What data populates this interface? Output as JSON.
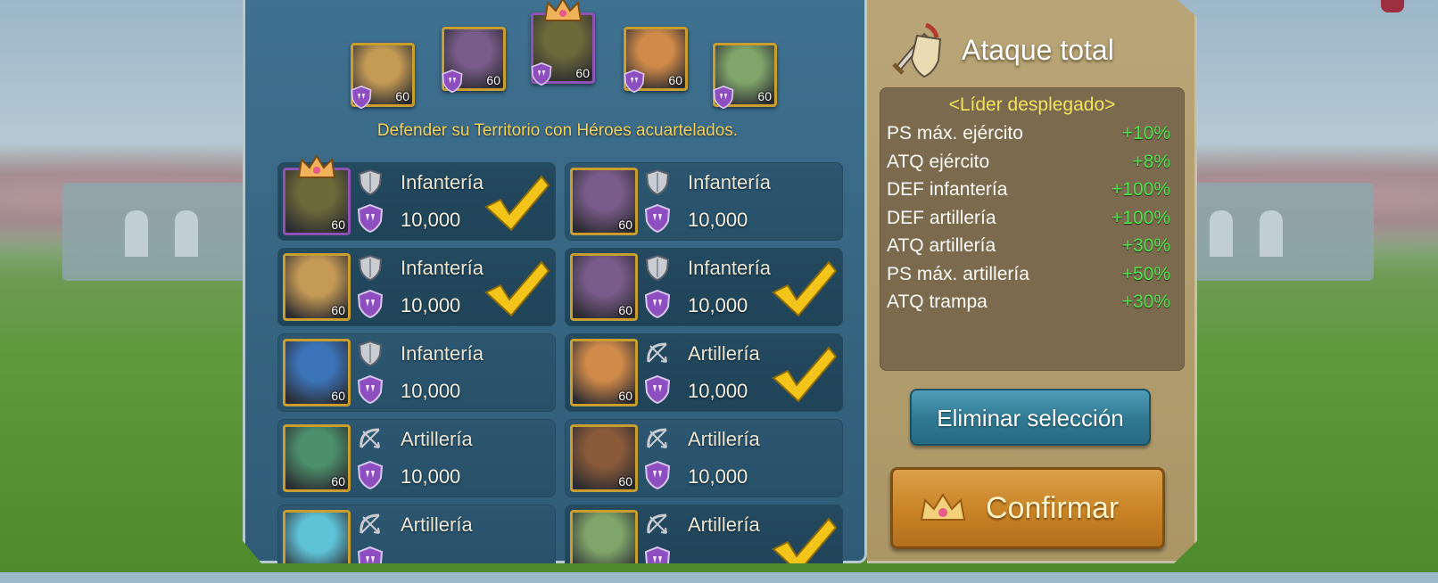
{
  "screen": {
    "subtitle": "Defender su Territorio con Héroes acuartelados."
  },
  "top_heroes": [
    {
      "level": "60",
      "leader": false,
      "palette": "#c59a55"
    },
    {
      "level": "60",
      "leader": false,
      "palette": "#7a5c8a"
    },
    {
      "level": "60",
      "leader": true,
      "palette": "#6b6a3a"
    },
    {
      "level": "60",
      "leader": false,
      "palette": "#d08a4a"
    },
    {
      "level": "60",
      "leader": false,
      "palette": "#7fa56a"
    }
  ],
  "hero_cards": [
    {
      "type_label": "Infantería",
      "troops": "10,000",
      "level": "60",
      "type_icon": "shield-icon",
      "selected": true,
      "leader": true,
      "palette": "#6b6a3a"
    },
    {
      "type_label": "Infantería",
      "troops": "10,000",
      "level": "60",
      "type_icon": "shield-icon",
      "selected": false,
      "leader": false,
      "palette": "#7a5c8a"
    },
    {
      "type_label": "Infantería",
      "troops": "10,000",
      "level": "60",
      "type_icon": "shield-icon",
      "selected": true,
      "leader": false,
      "palette": "#c59a55"
    },
    {
      "type_label": "Infantería",
      "troops": "10,000",
      "level": "60",
      "type_icon": "shield-icon",
      "selected": true,
      "leader": false,
      "palette": "#7a5c8a"
    },
    {
      "type_label": "Infantería",
      "troops": "10,000",
      "level": "60",
      "type_icon": "shield-icon",
      "selected": false,
      "leader": false,
      "palette": "#3b74b8"
    },
    {
      "type_label": "Artillería",
      "troops": "10,000",
      "level": "60",
      "type_icon": "bow-icon",
      "selected": true,
      "leader": false,
      "palette": "#d08a4a"
    },
    {
      "type_label": "Artillería",
      "troops": "10,000",
      "level": "60",
      "type_icon": "bow-icon",
      "selected": false,
      "leader": false,
      "palette": "#4c8f6a"
    },
    {
      "type_label": "Artillería",
      "troops": "10,000",
      "level": "60",
      "type_icon": "bow-icon",
      "selected": false,
      "leader": false,
      "palette": "#8a5a3a"
    },
    {
      "type_label": "Artillería",
      "troops": "",
      "level": "",
      "type_icon": "bow-icon",
      "selected": false,
      "leader": false,
      "palette": "#5fc3d8"
    },
    {
      "type_label": "Artillería",
      "troops": "",
      "level": "",
      "type_icon": "bow-icon",
      "selected": true,
      "leader": false,
      "palette": "#7fa56a"
    }
  ],
  "sidebar": {
    "title": "Ataque total",
    "leader_header": "<Líder desplegado>",
    "bonuses": [
      {
        "label": "PS máx. ejército",
        "value": "+10%"
      },
      {
        "label": "ATQ ejército",
        "value": "+8%"
      },
      {
        "label": "DEF infantería",
        "value": "+100%"
      },
      {
        "label": "DEF artillería",
        "value": "+100%"
      },
      {
        "label": "ATQ artillería",
        "value": "+30%"
      },
      {
        "label": "PS máx. artillería",
        "value": "+50%"
      },
      {
        "label": "ATQ trampa",
        "value": "+30%"
      }
    ],
    "clear_button": "Eliminar selección",
    "confirm_button": "Confirmar"
  },
  "colors": {
    "gold_frame": "#c89f2f",
    "leader_frame": "#8d52b3",
    "bonus_green": "#50e04f",
    "header_yellow": "#f4e35f",
    "check_yellow": "#f3c51a"
  }
}
